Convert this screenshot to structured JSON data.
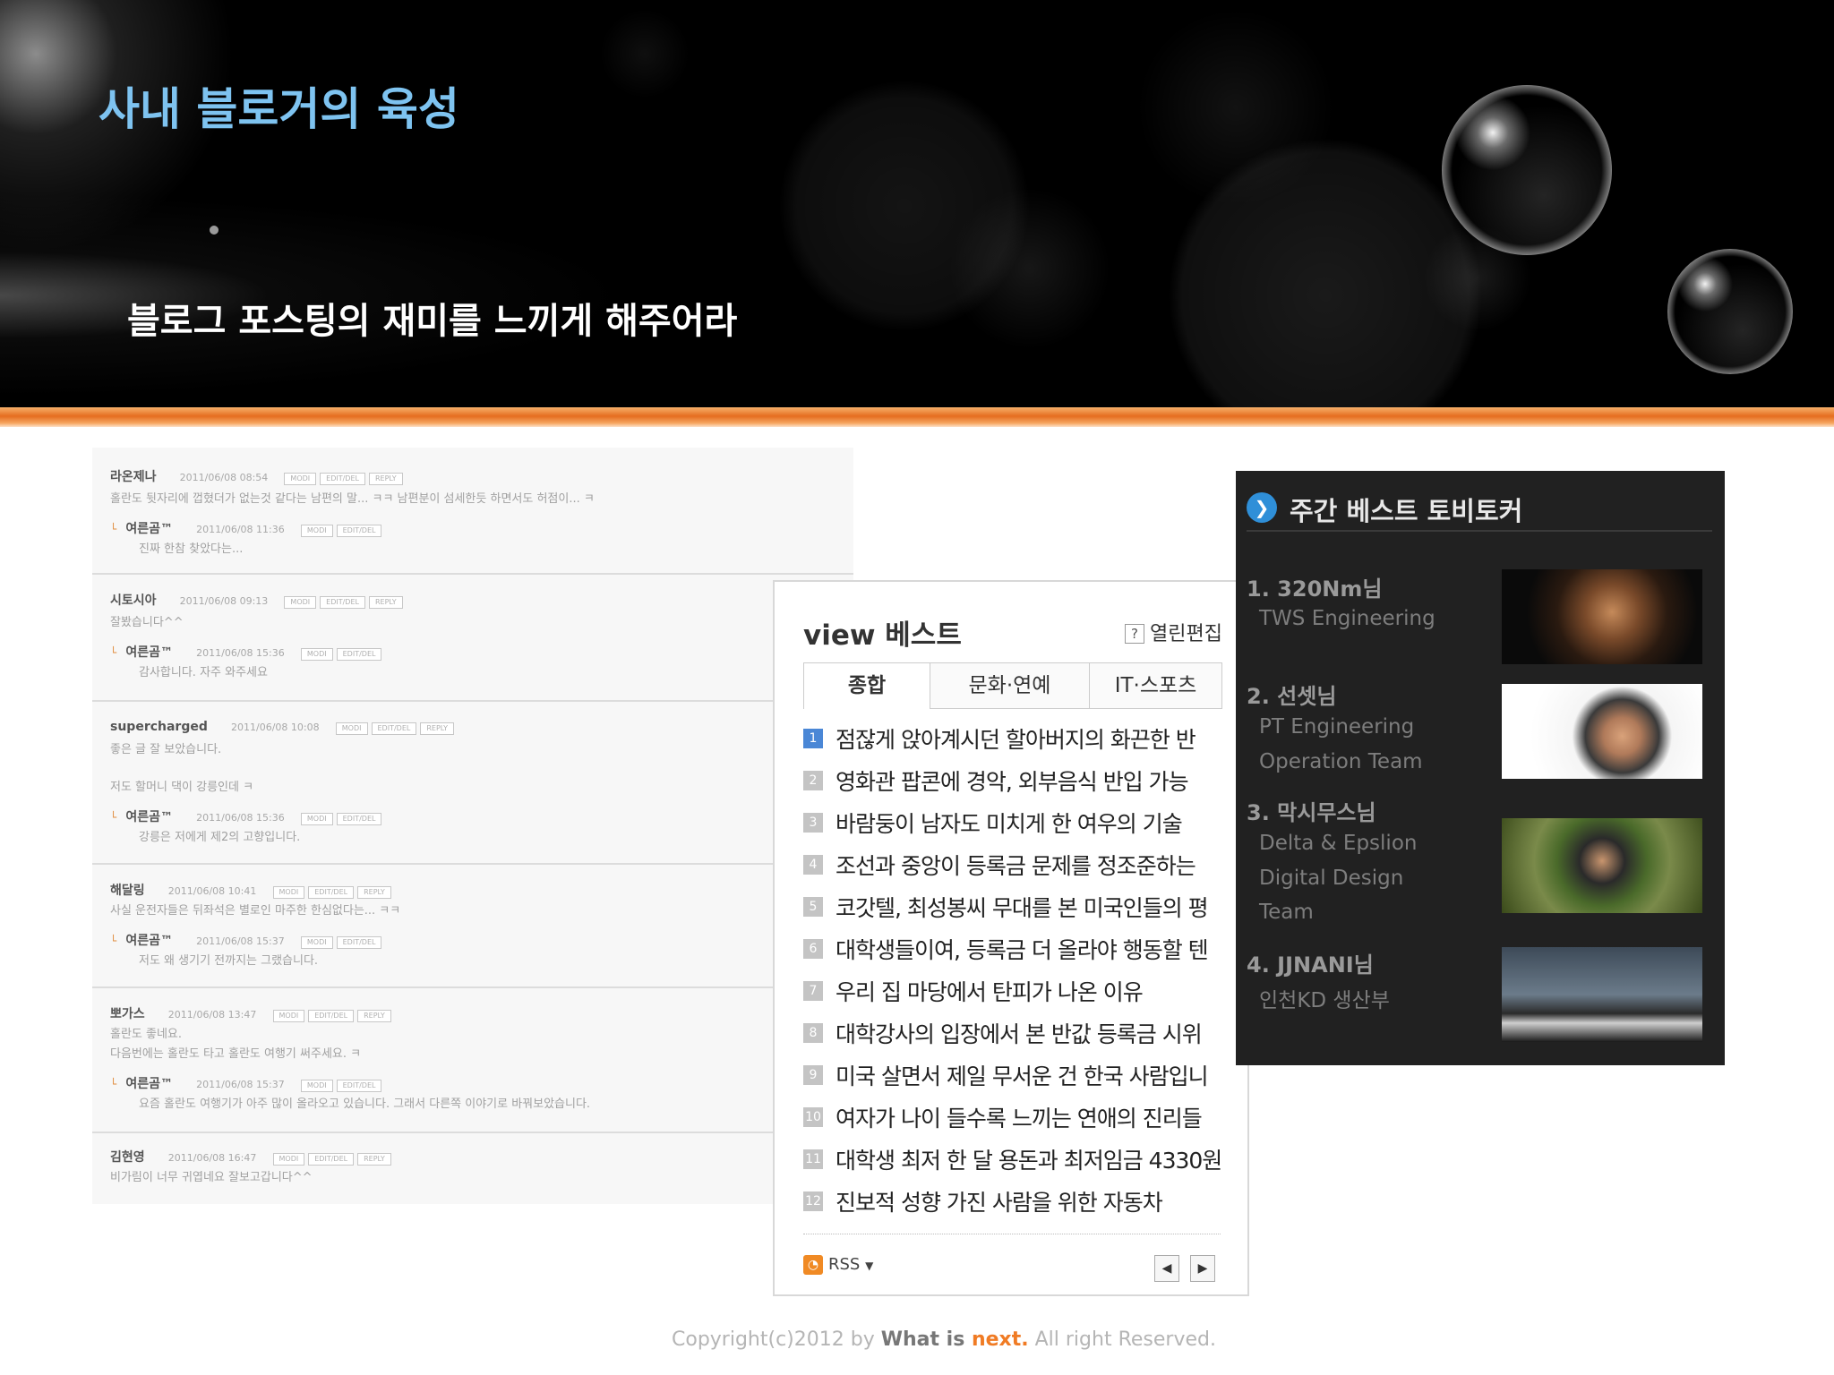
{
  "header": {
    "title": "사내 블로거의 육성",
    "subtitle": "블로그 포스팅의 재미를 느끼게 해주어라"
  },
  "comments_screenshot": {
    "buttons": [
      "MODI",
      "EDIT/DEL",
      "REPLY"
    ],
    "groups": [
      {
        "author": "라온제나",
        "date": "2011/06/08 08:54",
        "text": "홀란도 뒷자리에 껍혔더가 없는것 같다는 남편의 말... ㅋㅋ 남편분이 섬세한듯 하면서도 허점이... ㅋ",
        "reply": {
          "author": "여른곰™",
          "date": "2011/06/08 11:36",
          "text": "진짜 한참 찾았다는..."
        }
      },
      {
        "author": "시토시아",
        "date": "2011/06/08 09:13",
        "text": "잘봤습니다^^",
        "reply": {
          "author": "여른곰™",
          "date": "2011/06/08 15:36",
          "text": "감사합니다. 자주 와주세요"
        }
      },
      {
        "author": "supercharged",
        "date": "2011/06/08 10:08",
        "text": "좋은 글 잘 보았습니다.",
        "text2": "저도 할머니 댁이 강릉인데 ㅋ",
        "reply": {
          "author": "여른곰™",
          "date": "2011/06/08 15:36",
          "text": "강릉은 저에게 제2의 고향입니다."
        }
      },
      {
        "author": "해달링",
        "date": "2011/06/08 10:41",
        "text": "사실 운전자들은 뒤좌석은 별로인 마주한 한심없다는... ㅋㅋ",
        "reply": {
          "author": "여른곰™",
          "date": "2011/06/08 15:37",
          "text": "저도 왜 생기기 전까지는 그랬습니다."
        }
      },
      {
        "author": "뽀가스",
        "date": "2011/06/08 13:47",
        "text": "홀란도 좋네요.",
        "text2": "다음번에는 홀란도 타고 홀란도 여행기 써주세요. ㅋ",
        "reply": {
          "author": "여른곰™",
          "date": "2011/06/08 15:37",
          "text": "요즘 홀란도 여행기가 아주 많이 올라오고 있습니다. 그래서 다른쪽 이야기로 바꿔보았습니다."
        }
      },
      {
        "author": "김현영",
        "date": "2011/06/08 16:47",
        "text": "비가림이 너무 귀엽네요 잘보고갑니다^^"
      }
    ]
  },
  "view_best": {
    "title": "view 베스트",
    "open_edit_label": "열린편집",
    "help_icon": "?",
    "tabs": [
      {
        "label": "종합",
        "active": true
      },
      {
        "label": "문화·연예",
        "active": false
      },
      {
        "label": "IT·스포츠",
        "active": false
      }
    ],
    "items": [
      {
        "rank": "1",
        "text": "점잖게 앉아계시던 할아버지의 화끈한 반"
      },
      {
        "rank": "2",
        "text": "영화관 팝콘에 경악, 외부음식 반입 가능"
      },
      {
        "rank": "3",
        "text": "바람둥이 남자도 미치게 한 여우의 기술"
      },
      {
        "rank": "4",
        "text": "조선과 중앙이 등록금 문제를 정조준하는"
      },
      {
        "rank": "5",
        "text": "코갓텔, 최성봉씨 무대를 본 미국인들의 평"
      },
      {
        "rank": "6",
        "text": "대학생들이여, 등록금 더 올라야 행동할 텐"
      },
      {
        "rank": "7",
        "text": "우리 집 마당에서 탄피가 나온 이유"
      },
      {
        "rank": "8",
        "text": "대학강사의 입장에서 본 반값 등록금 시위"
      },
      {
        "rank": "9",
        "text": "미국 살면서 제일 무서운 건 한국 사람입니"
      },
      {
        "rank": "10",
        "text": "여자가 나이 들수록 느끼는 연애의 진리들"
      },
      {
        "rank": "11",
        "text": "대학생 최저 한 달 용돈과 최저임금 4330원"
      },
      {
        "rank": "12",
        "text": "진보적 성향 가진 사람을 위한 자동차"
      }
    ],
    "rss_label": "RSS",
    "prev_icon": "◀",
    "next_icon": "▶"
  },
  "weekly_best": {
    "title": "주간 베스트 토비토커",
    "arrow_icon": "❯",
    "people": [
      {
        "name": "1. 320Nm님",
        "desc": [
          "TWS Engineering"
        ]
      },
      {
        "name": "2. 선셋님",
        "desc": [
          "PT Engineering",
          "Operation Team"
        ]
      },
      {
        "name": "3. 막시무스님",
        "desc": [
          "Delta & Epslion",
          "Digital Design",
          "Team"
        ]
      },
      {
        "name": "4. JJNANI님",
        "desc": [
          "인천KD 생산부"
        ]
      }
    ]
  },
  "footer": {
    "prefix": "Copyright(c)2012 by ",
    "brand_what": "What is ",
    "brand_next": "next.",
    "suffix": " All right Reserved."
  },
  "colors": {
    "title": "#7ec3f0",
    "band_orange": "#e56d1f",
    "rank_first": "#4a87d6",
    "footer_accent": "#f07b24"
  }
}
